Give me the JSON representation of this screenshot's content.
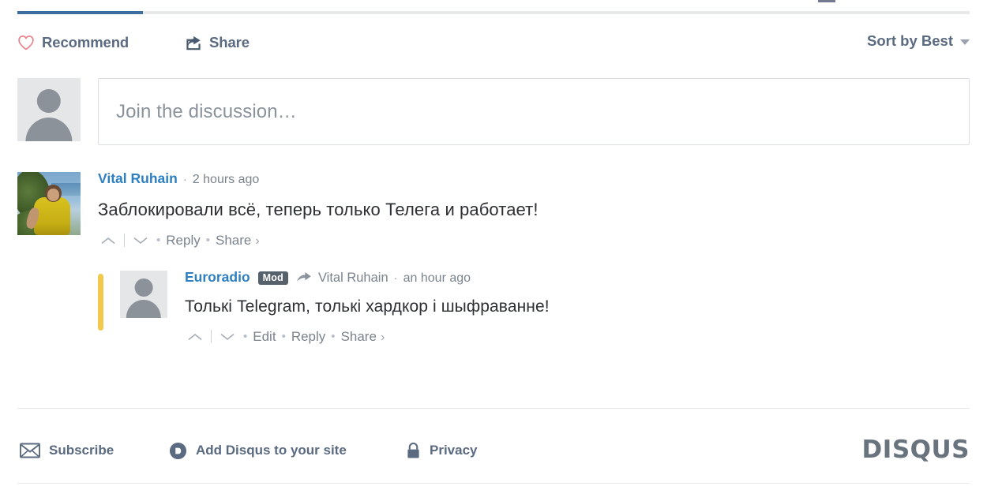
{
  "header": {
    "active_tab_accent": "#3c6f9e",
    "recommend_label": "Recommend",
    "recommend_icon": "heart-icon",
    "share_label": "Share",
    "share_icon": "share-arrow-icon",
    "sort_label": "Sort by Best",
    "sort_caret_icon": "chevron-down-icon"
  },
  "composer": {
    "placeholder": "Join the discussion…",
    "avatar_icon": "default-avatar-icon"
  },
  "comments": [
    {
      "author": "Vital Ruhain",
      "avatar_icon": "user-photo-avatar",
      "timestamp": "2 hours ago",
      "text": "Заблокировали всё, теперь только Телега и работает!",
      "actions": {
        "upvote_icon": "chevron-up-icon",
        "downvote_icon": "chevron-down-icon",
        "reply_label": "Reply",
        "share_label": "Share"
      },
      "reply": {
        "author": "Euroradio",
        "avatar_icon": "default-avatar-icon",
        "badge": "Mod",
        "reply_to_icon": "reply-arrow-icon",
        "reply_to": "Vital Ruhain",
        "timestamp": "an hour ago",
        "text": "Толькі Telegram, толькі хардкор і шыфраванне!",
        "highlight_color": "#f2c94c",
        "actions": {
          "upvote_icon": "chevron-up-icon",
          "downvote_icon": "chevron-down-icon",
          "edit_label": "Edit",
          "reply_label": "Reply",
          "share_label": "Share"
        }
      }
    }
  ],
  "footer": {
    "subscribe_label": "Subscribe",
    "subscribe_icon": "envelope-icon",
    "add_disqus_label": "Add Disqus to your site",
    "add_disqus_icon": "disqus-d-icon",
    "privacy_label": "Privacy",
    "privacy_icon": "lock-icon",
    "brand": "DISQUS",
    "brand_color": "#68737e"
  },
  "separators": {
    "dot": "·",
    "bullet": "•"
  }
}
